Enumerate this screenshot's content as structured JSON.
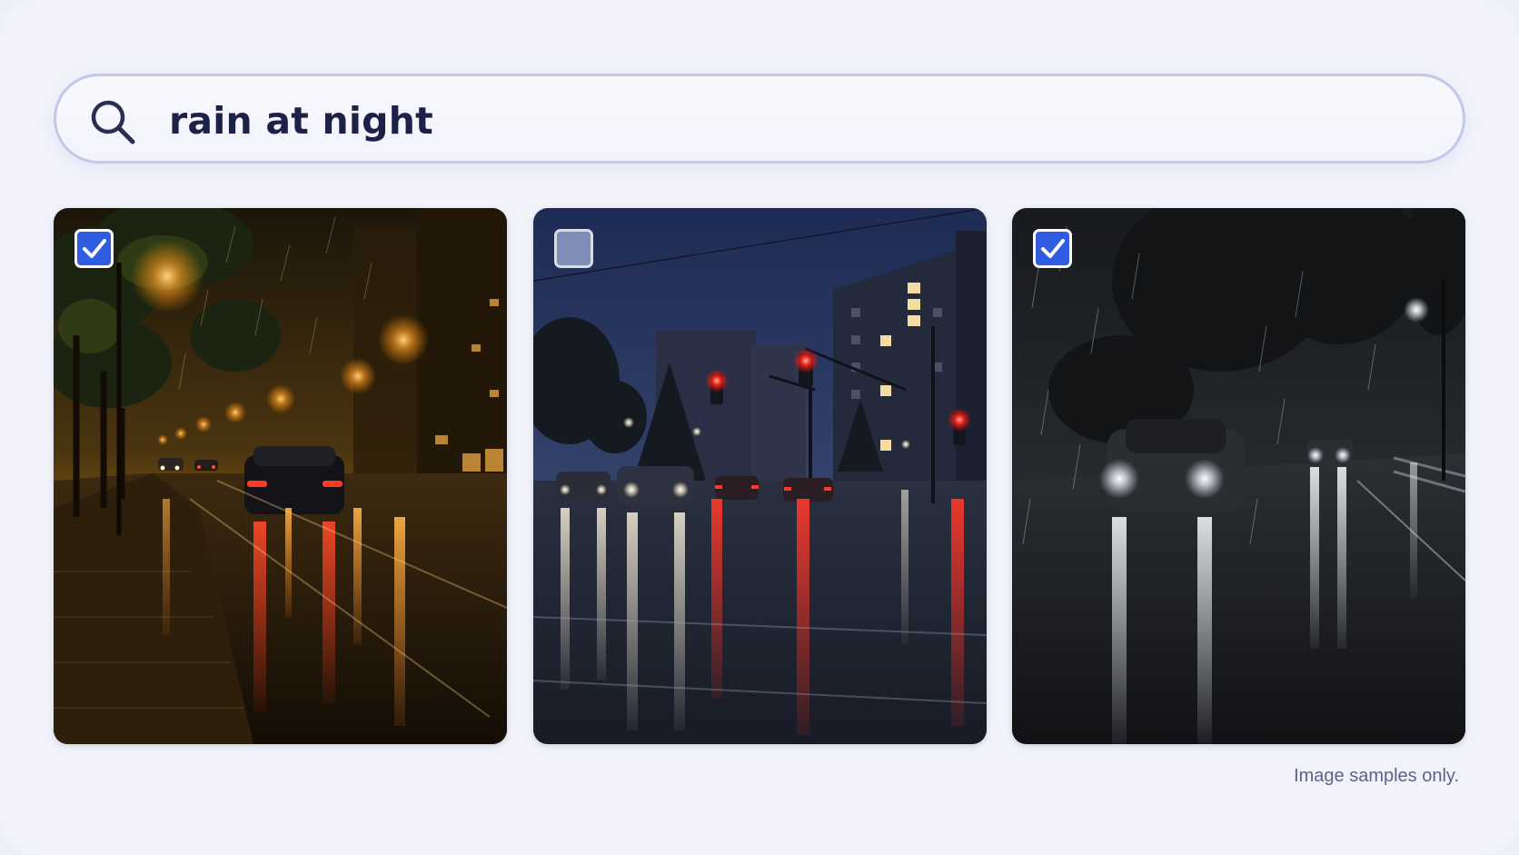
{
  "search": {
    "query": "rain at night"
  },
  "results": [
    {
      "checked": true,
      "checkbox_color": "#2f5ce0"
    },
    {
      "checked": false,
      "checkbox_color": "#8895bf"
    },
    {
      "checked": true,
      "checkbox_color": "#2f5ce0"
    }
  ],
  "footer": {
    "note": "Image samples only."
  },
  "colors": {
    "background": "#f1f2fa",
    "search_border": "#c2c8ec",
    "query_text": "#1d2147",
    "accent": "#2f5ce0"
  },
  "icons": {
    "search": "search-icon",
    "checkmark": "check-icon"
  }
}
